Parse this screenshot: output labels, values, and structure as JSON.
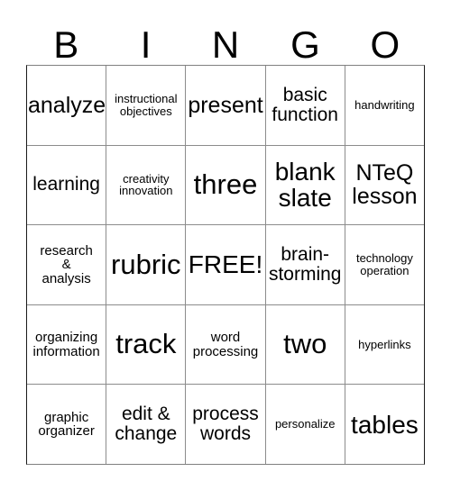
{
  "card": {
    "title_letters": [
      "B",
      "I",
      "N",
      "G",
      "O"
    ],
    "rows": [
      [
        {
          "text": "analyze",
          "size": "lg"
        },
        {
          "text": "instructional\nobjectives",
          "size": "xs"
        },
        {
          "text": "present",
          "size": "lg"
        },
        {
          "text": "basic\nfunction",
          "size": "md"
        },
        {
          "text": "handwriting",
          "size": "xs"
        }
      ],
      [
        {
          "text": "learning",
          "size": "md"
        },
        {
          "text": "creativity\ninnovation",
          "size": "xs"
        },
        {
          "text": "three",
          "size": "xxl"
        },
        {
          "text": "blank\nslate",
          "size": "xl"
        },
        {
          "text": "NTeQ\nlesson",
          "size": "lg"
        }
      ],
      [
        {
          "text": "research\n&\nanalysis",
          "size": "sm"
        },
        {
          "text": "rubric",
          "size": "xxl"
        },
        {
          "text": "FREE!",
          "size": "xl"
        },
        {
          "text": "brain-\nstorming",
          "size": "md"
        },
        {
          "text": "technology\noperation",
          "size": "xs"
        }
      ],
      [
        {
          "text": "organizing\ninformation",
          "size": "sm"
        },
        {
          "text": "track",
          "size": "xxl"
        },
        {
          "text": "word\nprocessing",
          "size": "sm"
        },
        {
          "text": "two",
          "size": "xxl"
        },
        {
          "text": "hyperlinks",
          "size": "xs"
        }
      ],
      [
        {
          "text": "graphic\norganizer",
          "size": "sm"
        },
        {
          "text": "edit &\nchange",
          "size": "md"
        },
        {
          "text": "process\nwords",
          "size": "md"
        },
        {
          "text": "personalize",
          "size": "xs"
        },
        {
          "text": "tables",
          "size": "xl"
        }
      ]
    ]
  },
  "colors": {
    "background": "#ffffff",
    "text": "#000000",
    "grid_line": "#8c8c8c",
    "outer_border": "#1a1a1a"
  }
}
